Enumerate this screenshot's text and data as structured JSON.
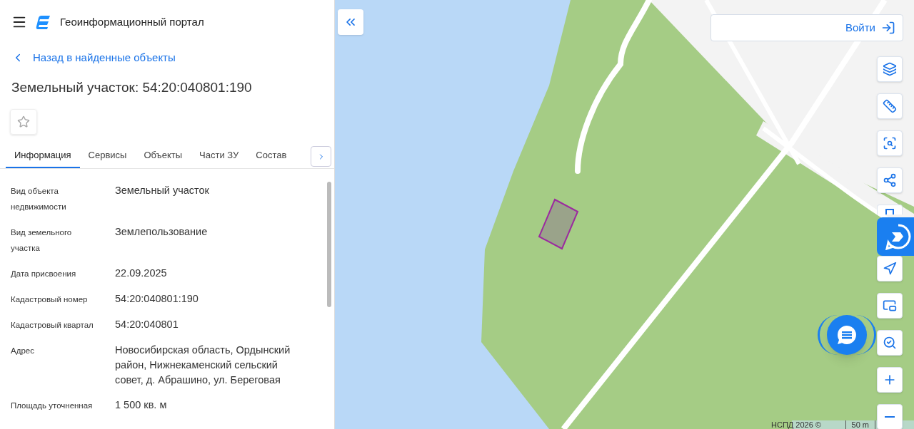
{
  "header": {
    "title": "Геоинформационный портал"
  },
  "back_link": "Назад в найденные объекты",
  "object_title": "Земельный участок: 54:20:040801:190",
  "favorite": {
    "checked": false
  },
  "tabs": [
    {
      "label": "Информация",
      "selected": true
    },
    {
      "label": "Сервисы",
      "selected": false
    },
    {
      "label": "Объекты",
      "selected": false
    },
    {
      "label": "Части ЗУ",
      "selected": false
    },
    {
      "label": "Состав",
      "selected": false
    }
  ],
  "properties": [
    {
      "label": "Вид объекта недвижимости",
      "value": "Земельный участок"
    },
    {
      "label": "Вид земельного участка",
      "value": "Землепользование"
    },
    {
      "label": "Дата присвоения",
      "value": "22.09.2025"
    },
    {
      "label": "Кадастровый номер",
      "value": "54:20:040801:190"
    },
    {
      "label": "Кадастровый квартал",
      "value": "54:20:040801"
    },
    {
      "label": "Адрес",
      "value": "Новосибирская область, Ордынский район, Нижнекаменский сельский совет, д. Абрашино, ул. Береговая"
    },
    {
      "label": "Площадь уточненная",
      "value": "1 500 кв. м"
    }
  ],
  "map": {
    "login_button": "Войти",
    "attribution": "НСПД 2026 ©",
    "scale": "50 m"
  }
}
